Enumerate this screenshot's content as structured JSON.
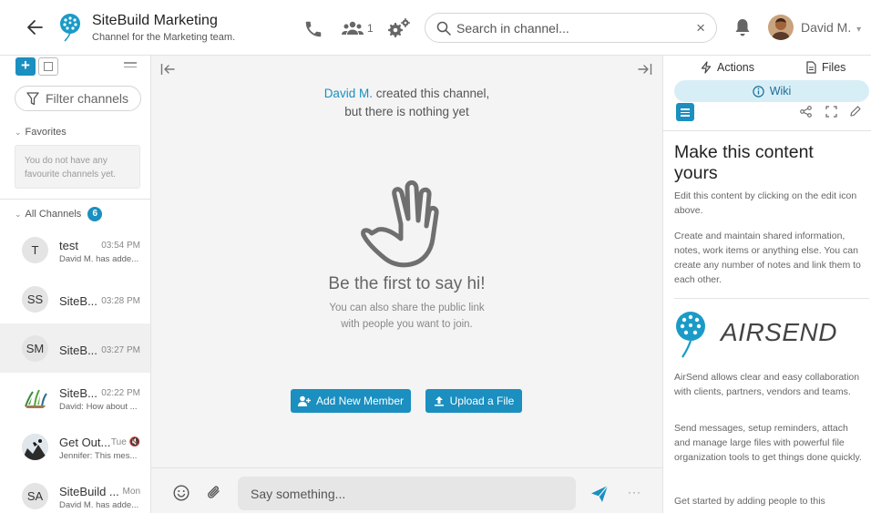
{
  "header": {
    "channel_name": "SiteBuild Marketing",
    "channel_sub": "Channel for the Marketing team.",
    "members_count": "1",
    "search_placeholder": "Search in channel...",
    "clear": "×",
    "user_name": "David M.",
    "user_caret": "▾"
  },
  "sidebar": {
    "add": "+",
    "filter_placeholder": "Filter channels",
    "favorites_label": "Favorites",
    "favorites_empty": "You do not have any favourite channels yet.",
    "all_label": "All Channels",
    "all_count": "6",
    "channels": [
      {
        "initials": "T",
        "title": "test",
        "time": "03:54 PM",
        "sub": "David M. has adde..."
      },
      {
        "initials": "SS",
        "title": "SiteB...",
        "time": "03:28 PM",
        "sub": ""
      },
      {
        "initials": "SM",
        "title": "SiteB...",
        "time": "03:27 PM",
        "sub": ""
      },
      {
        "initials": "",
        "title": "SiteB...",
        "time": "02:22 PM",
        "sub": "David: How about ..."
      },
      {
        "initials": "",
        "title": "Get Out...",
        "time": "Tue 🔇",
        "sub": "Jennifer: This mes..."
      },
      {
        "initials": "SA",
        "title": "SiteBuild ...",
        "time": "Mon",
        "sub": "David M. has adde..."
      }
    ]
  },
  "center": {
    "created_name": "David M.",
    "created_rest": " created this channel,",
    "created_line2": "but there is nothing yet",
    "say_hi": "Be the first to say hi!",
    "say_sub_1": "You can also share the public link",
    "say_sub_2": "with people you want to join.",
    "add_member": "Add New Member",
    "upload": "Upload a File",
    "composer_placeholder": "Say something...",
    "more": "···"
  },
  "right": {
    "tab_actions": "Actions",
    "tab_files": "Files",
    "tab_wiki": "Wiki",
    "wiki_title": "Make this content yours",
    "p1": "Edit this content by clicking on the edit icon above.",
    "p2": "Create and maintain shared information, notes, work items or anything else. You can create any number of notes and link them to each other.",
    "brand": "AIRSEND",
    "p3": "AirSend allows clear and easy collaboration with clients, partners, vendors and teams.",
    "p4": "Send messages, setup reminders, attach and manage large files with powerful file organization tools to get things done quickly.",
    "p5": "Get started by adding people to this"
  },
  "colors": {
    "accent": "#1a8fc0",
    "wiki_tab_bg": "#d8eef7",
    "center_bg": "#f4f4f4"
  },
  "icons": [
    "back-arrow-icon",
    "dandelion-logo-icon",
    "phone-icon",
    "members-icon",
    "settings-icon",
    "search-icon",
    "bell-icon",
    "filter-icon",
    "hand-wave-icon",
    "emoji-icon",
    "paperclip-icon",
    "send-icon",
    "bolt-icon",
    "file-icon",
    "info-icon",
    "share-icon",
    "fullscreen-icon",
    "edit-icon"
  ]
}
